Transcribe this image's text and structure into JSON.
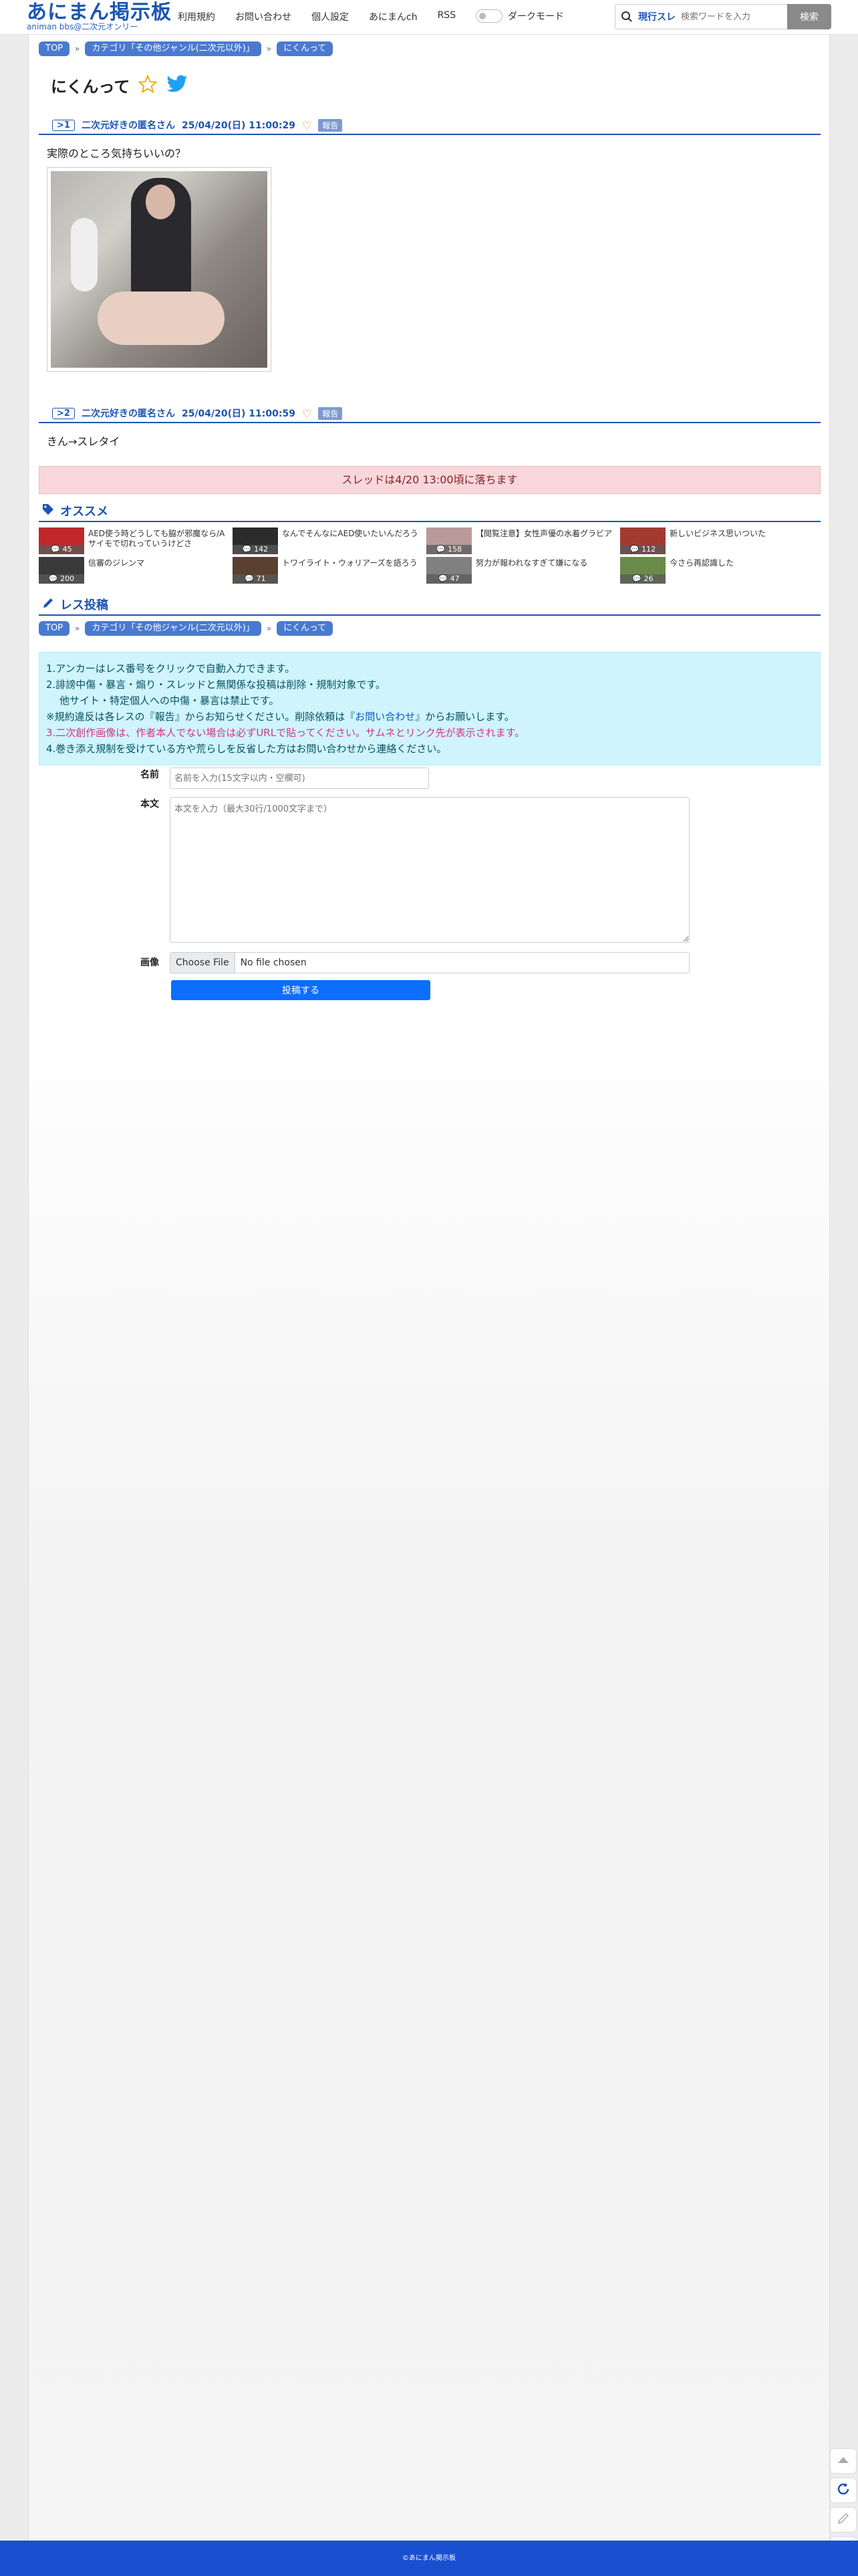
{
  "header": {
    "logo_main": "あにまん掲示板",
    "logo_sub": "animan bbs@二次元オンリー",
    "nav": [
      "利用規約",
      "お問い合わせ",
      "個人設定",
      "あにまんch",
      "RSS"
    ],
    "dark_mode_label": "ダークモード",
    "search_scope": "現行スレ",
    "search_placeholder": "検索ワードを入力",
    "search_button": "検索"
  },
  "breadcrumb": {
    "top": "TOP",
    "category": "カテゴリ「その他ジャンル(二次元以外)」",
    "thread": "にくんって"
  },
  "thread": {
    "title": "にくんって"
  },
  "posts": [
    {
      "no": ">1",
      "name": "二次元好きの匿名さん",
      "date": "25/04/20(日) 11:00:29",
      "report": "報告",
      "body": "実際のところ気持ちいいの？"
    },
    {
      "no": ">2",
      "name": "二次元好きの匿名さん",
      "date": "25/04/20(日) 11:00:59",
      "report": "報告",
      "body": "きん→スレタイ"
    }
  ],
  "notice": "スレッドは4/20 13:00頃に落ちます",
  "recommend": {
    "heading": "オススメ",
    "items": [
      {
        "title": "AED使う時どうしても脇が邪魔なら/Aサイモで切れっていうけどさ",
        "count": "45",
        "color": "#c0282a"
      },
      {
        "title": "なんでそんなにAED使いたいんだろう",
        "count": "142",
        "color": "#2b2b2b"
      },
      {
        "title": "【閲覧注意】女性声優の水着グラビア",
        "count": "158",
        "color": "#b89a9a"
      },
      {
        "title": "新しいビジネス思いついた",
        "count": "112",
        "color": "#a23a32"
      },
      {
        "title": "信審のジレンマ",
        "count": "200",
        "color": "#3a3a3a"
      },
      {
        "title": "トワイライト・ウォリアーズを語ろう",
        "count": "71",
        "color": "#5a4030"
      },
      {
        "title": "努力が報われなすぎて嫌になる",
        "count": "47",
        "color": "#808080"
      },
      {
        "title": "今さら再認識した",
        "count": "26",
        "color": "#6a8a4a"
      }
    ]
  },
  "reply": {
    "heading": "レス投稿",
    "rules": {
      "line1": "1.アンカーはレス番号をクリックで自動入力できます。",
      "line2": "2.誹謗中傷・暴言・煽り・スレッドと無関係な投稿は削除・規制対象です。",
      "line2b": "他サイト・特定個人への中傷・暴言は禁止です。",
      "line3a": "※規約違反は各レスの『報告』からお知らせください。削除依頼は『",
      "line3link": "お問い合わせ",
      "line3b": "』からお願いします。",
      "line4": "3.二次創作画像は、作者本人でない場合は必ずURLで貼ってください。サムネとリンク先が表示されます。",
      "line5": "4.巻き添え規制を受けている方や荒らしを反省した方はお問い合わせから連絡ください。"
    },
    "name_label": "名前",
    "name_placeholder": "名前を入力(15文字以内・空欄可)",
    "body_label": "本文",
    "body_placeholder": "本文を入力（最大30行/1000文字まで）",
    "image_label": "画像",
    "file_button": "Choose File",
    "file_text": "No file chosen",
    "submit": "投稿する"
  },
  "footer": "©あにまん掲示板"
}
